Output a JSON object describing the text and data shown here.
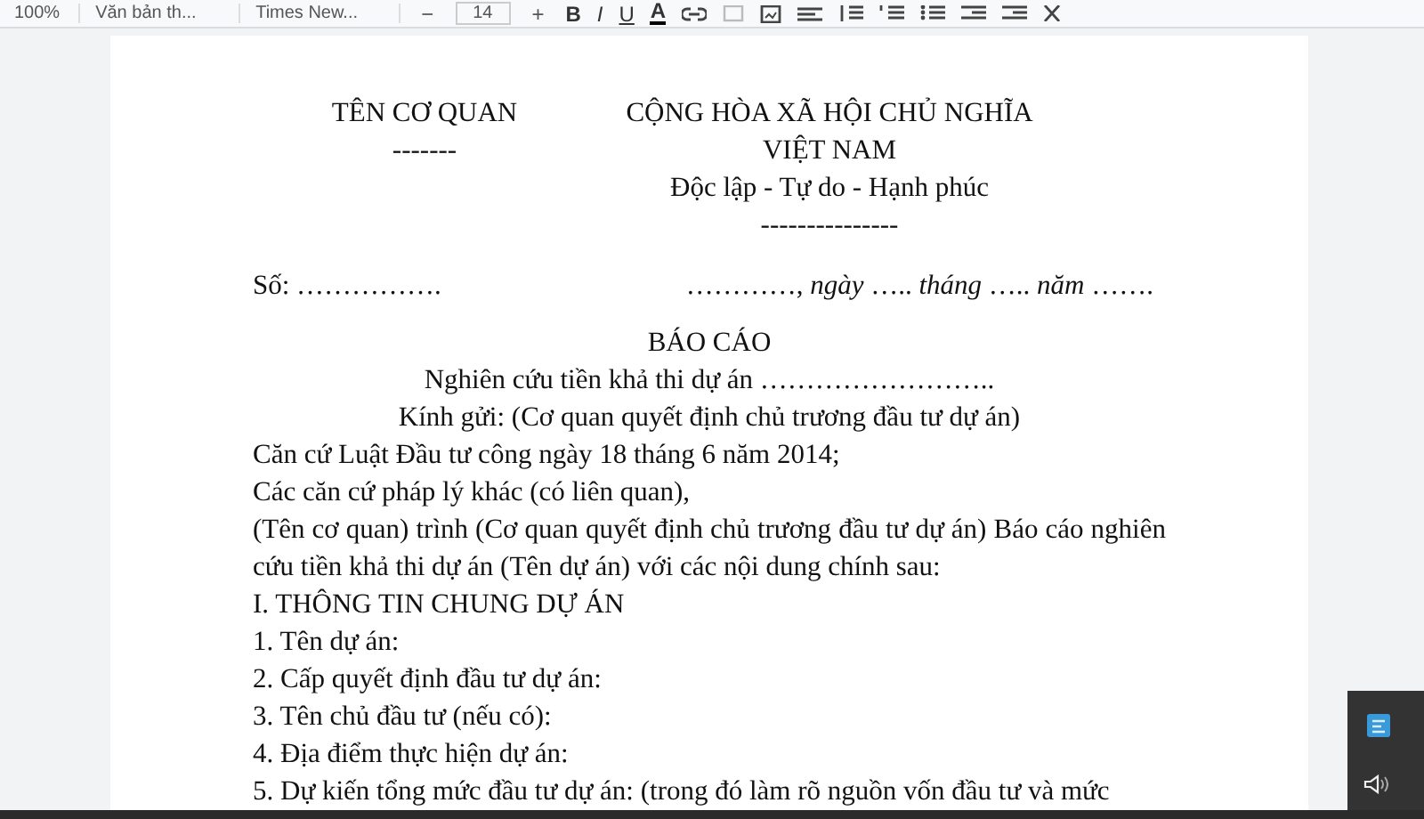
{
  "toolbar": {
    "zoom": "100%",
    "style": "Văn bản th...",
    "font": "Times New...",
    "font_size": "14",
    "size_minus": "−",
    "size_plus": "+",
    "format_buttons": [
      "B",
      "I",
      "U",
      "A"
    ]
  },
  "header": {
    "left": {
      "org": "TÊN CƠ QUAN",
      "rule": "-------"
    },
    "right": {
      "nation": "CỘNG HÒA XÃ HỘI CHỦ NGHĨA VIỆT NAM",
      "motto": "Độc lập - Tự do - Hạnh phúc",
      "rule": "---------------"
    }
  },
  "number_line": {
    "number": "Số: …………….",
    "date": "…………, *ngày* ….. *tháng* ….. *năm* ……."
  },
  "title": "BÁO CÁO",
  "subtitle": "Nghiên cứu tiền khả thi dự án ……………………..",
  "recipient": "Kính gửi: (Cơ quan quyết định chủ trương đầu tư dự án)",
  "paragraphs": [
    "Căn cứ Luật Đầu tư công ngày 18 tháng 6 năm 2014;",
    "Các căn cứ pháp lý khác (có liên quan),",
    "(Tên cơ quan) trình (Cơ quan quyết định chủ trương đầu tư dự án) Báo cáo nghiên cứu tiền khả thi dự án (Tên dự án) với các nội dung chính sau:",
    "I. THÔNG TIN CHUNG DỰ ÁN",
    "1. Tên dự án:",
    "2. Cấp quyết định đầu tư dự án:",
    "3. Tên chủ đầu tư (nếu có):",
    "4. Địa điểm thực hiện dự án:",
    "5. Dự kiến tổng mức đầu tư dự án: (trong đó làm rõ nguồn vốn đầu tư và mức"
  ]
}
